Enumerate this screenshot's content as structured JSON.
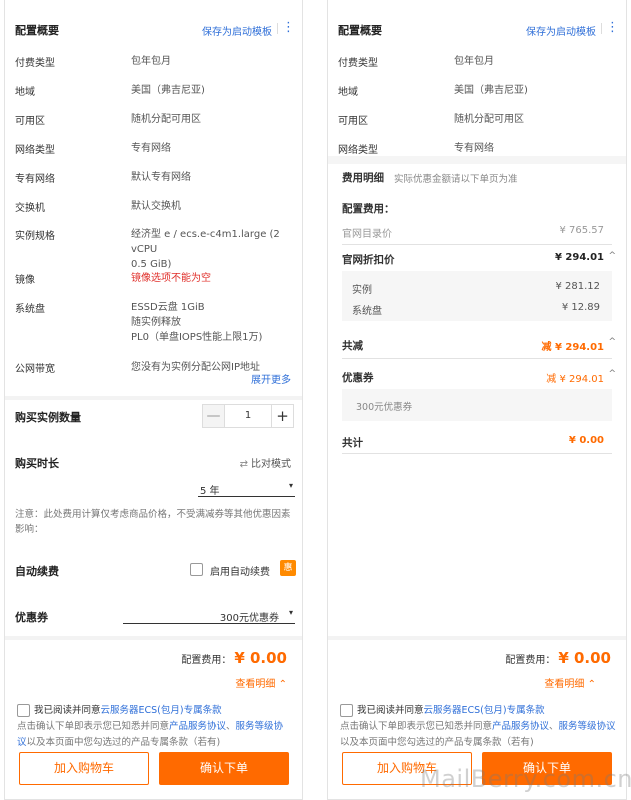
{
  "summary": {
    "title": "配置概要",
    "save_template": "保存为启动模板",
    "more_glyph": "⋮",
    "rows": [
      {
        "key": "付费类型",
        "value": "包年包月"
      },
      {
        "key": "地域",
        "value": "美国（弗吉尼亚)"
      },
      {
        "key": "可用区",
        "value": "随机分配可用区"
      },
      {
        "key": "网络类型",
        "value": "专有网络"
      },
      {
        "key": "专有网络",
        "value": "默认专有网络"
      },
      {
        "key": "交换机",
        "value": "默认交换机"
      },
      {
        "key": "实例规格",
        "value_lines": [
          "经济型 e / ecs.e-c4m1.large (2 vCPU",
          "0.5 GiB)"
        ]
      },
      {
        "key": "镜像",
        "value": "镜像选项不能为空"
      },
      {
        "key": "系统盘",
        "value_lines": [
          "ESSD云盘 1GiB",
          "随实例释放",
          "PL0（单盘IOPS性能上限1万)"
        ]
      },
      {
        "key": "公网带宽",
        "value": "您没有为实例分配公网IP地址"
      }
    ],
    "expand_more": "展开更多"
  },
  "quantity": {
    "label": "购买实例数量",
    "value": "1",
    "minus": "—",
    "plus": "+"
  },
  "duration": {
    "label": "购买时长",
    "compare_icon": "⇄",
    "compare": "比对模式",
    "selected": "5 年",
    "caret": "▾"
  },
  "note": "注意：此处费用计算仅考虑商品价格，不受满减券等其他优惠因素影响：",
  "auto_renew": {
    "label": "自动续费",
    "checkbox_label": "启用自动续费",
    "badge": "惠"
  },
  "coupon": {
    "label": "优惠券",
    "selected": "300元优惠券",
    "caret": "▾"
  },
  "footer": {
    "fee_label": "配置费用：",
    "fee_amount": "¥ 0.00",
    "view_detail": "查看明细",
    "collapse_glyph": "⌃",
    "agree_prefix": "我已阅读并同意",
    "agree_link": "云服务器ECS(包月)专属条款",
    "agree_note_1": "点击确认下单即表示您已知悉并同意",
    "agree_link_2": "产品服务协议",
    "agree_sep": "、",
    "agree_link_3": "服务等级协议",
    "agree_note_2": "以及本页面中您勾选过的产品专属条款（若有)",
    "add_cart": "加入购物车",
    "confirm": "确认下单"
  },
  "right_rows": [
    {
      "key": "付费类型",
      "value": "包年包月"
    },
    {
      "key": "地域",
      "value": "美国（弗吉尼亚)"
    },
    {
      "key": "可用区",
      "value": "随机分配可用区"
    },
    {
      "key": "网络类型",
      "value": "专有网络"
    }
  ],
  "payment": {
    "title": "费用明细",
    "subtitle": "实际优惠金额请以下单页为准",
    "config_fee_label": "配置费用：",
    "list_price_label": "官网目录价",
    "list_price": "¥ 765.57",
    "discount_label": "官网折扣价",
    "discount_price": "¥ 294.01",
    "instance_label": "实例",
    "instance_price": "¥ 281.12",
    "disk_label": "系统盘",
    "disk_price": "¥ 12.89",
    "saving_label": "共减",
    "saving": "减 ¥ 294.01",
    "coupon_label": "优惠券",
    "coupon_saving": "减 ¥ 294.01",
    "coupon_item": "300元优惠券",
    "total_label": "共计",
    "total": "¥ 0.00",
    "chevron": "^"
  },
  "watermark": "MailBerry.com.cn",
  "colors": {
    "accent": "#ff6a00",
    "link": "#2f6fd8",
    "error": "#e0302b"
  }
}
